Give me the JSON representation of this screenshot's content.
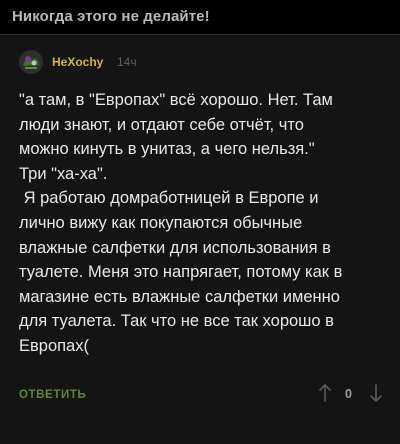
{
  "post": {
    "title": "Никогда этого не делайте!"
  },
  "comment": {
    "author": "HeXochy",
    "time": "14ч",
    "lines": [
      "\"а там, в \"Европах\" всё хорошо. Нет. Там",
      "люди знают, и отдают себе отчёт, что",
      "можно кинуть в унитаз, а чего нельзя.\"",
      "Три \"ха-ха\".",
      " Я работаю домработницей в Европе и",
      "лично вижу как покупаются обычные",
      "влажные салфетки для использования в",
      "туалете. Меня это напрягает, потому как в",
      "магазине есть влажные салфетки именно",
      "для туалета. Так что не все так хорошо в",
      "Европах("
    ],
    "reply_label": "ОТВЕТИТЬ",
    "score": "0"
  },
  "icons": {
    "avatar": "avatar-image",
    "vote_up": "arrow-up-icon",
    "vote_down": "arrow-down-icon"
  },
  "colors": {
    "background": "#000000",
    "comment_background": "#141414",
    "author": "#d9b43a",
    "reply": "#5b8a2f"
  }
}
